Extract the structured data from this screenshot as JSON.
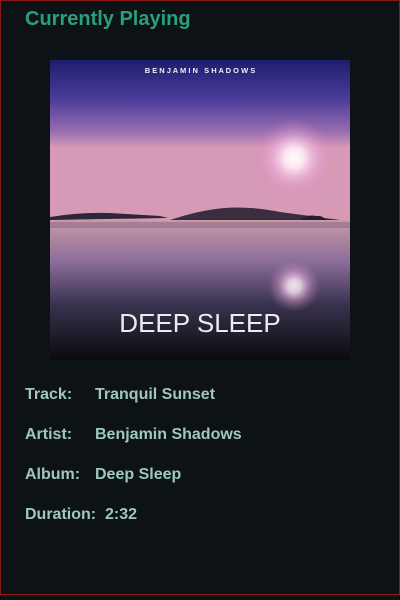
{
  "player": {
    "heading": "Currently Playing",
    "cover": {
      "artist_banner": "B E N J A M I N   S H A D O W S",
      "album_title": "DEEP SLEEP"
    },
    "fields": [
      {
        "label": "Track:",
        "value": "Tranquil Sunset"
      },
      {
        "label": "Artist:",
        "value": "Benjamin Shadows"
      },
      {
        "label": "Album:",
        "value": "Deep Sleep"
      },
      {
        "label": "Duration:",
        "value": "2:32"
      }
    ]
  },
  "colors": {
    "background": "#0d1216",
    "accent": "#2aa07a",
    "text": "#9ec8be"
  }
}
